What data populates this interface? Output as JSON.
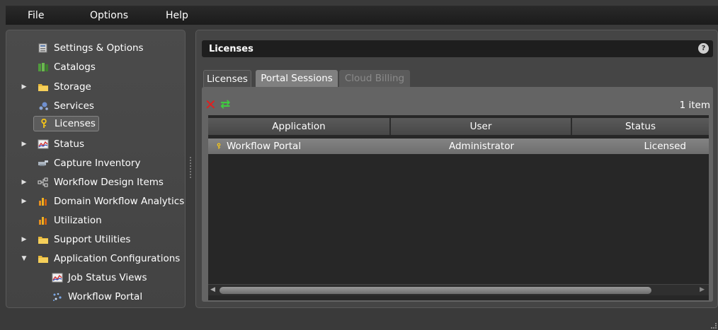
{
  "menubar": {
    "file": "File",
    "options": "Options",
    "help": "Help"
  },
  "tree": [
    {
      "label": "Settings & Options",
      "icon": "settings-icon",
      "expandable": false
    },
    {
      "label": "Catalogs",
      "icon": "catalogs-icon",
      "expandable": false
    },
    {
      "label": "Storage",
      "icon": "folder-icon",
      "expandable": true
    },
    {
      "label": "Services",
      "icon": "services-icon",
      "expandable": false
    },
    {
      "label": "Licenses",
      "icon": "key-icon",
      "expandable": false,
      "selected": true
    },
    {
      "label": "Status",
      "icon": "status-chart-icon",
      "expandable": true
    },
    {
      "label": "Capture Inventory",
      "icon": "capture-icon",
      "expandable": false
    },
    {
      "label": "Workflow Design Items",
      "icon": "workflow-icon",
      "expandable": true
    },
    {
      "label": "Domain Workflow Analytics",
      "icon": "analytics-icon",
      "expandable": true
    },
    {
      "label": "Utilization",
      "icon": "utilization-icon",
      "expandable": false
    },
    {
      "label": "Support Utilities",
      "icon": "folder-icon",
      "expandable": true
    },
    {
      "label": "Application Configurations",
      "icon": "folder-icon",
      "expandable": true,
      "expanded": true
    },
    {
      "label": "Job Status Views",
      "icon": "status-chart-icon",
      "child": true
    },
    {
      "label": "Workflow Portal",
      "icon": "portal-icon",
      "child": true
    }
  ],
  "panel": {
    "title": "Licenses",
    "help": "?",
    "tabs": [
      {
        "label": "Licenses",
        "active": false
      },
      {
        "label": "Portal Sessions",
        "active": true
      },
      {
        "label": "Cloud Billing",
        "disabled": true
      }
    ],
    "count": "1 item",
    "columns": [
      "Application",
      "User",
      "Status"
    ],
    "rows": [
      {
        "application": "Workflow Portal",
        "user": "Administrator",
        "status": "Licensed"
      }
    ]
  },
  "colors": {
    "accent": "#808080",
    "delete": "#e02020",
    "refresh": "#3fcf3f",
    "key": "#f5c518"
  }
}
